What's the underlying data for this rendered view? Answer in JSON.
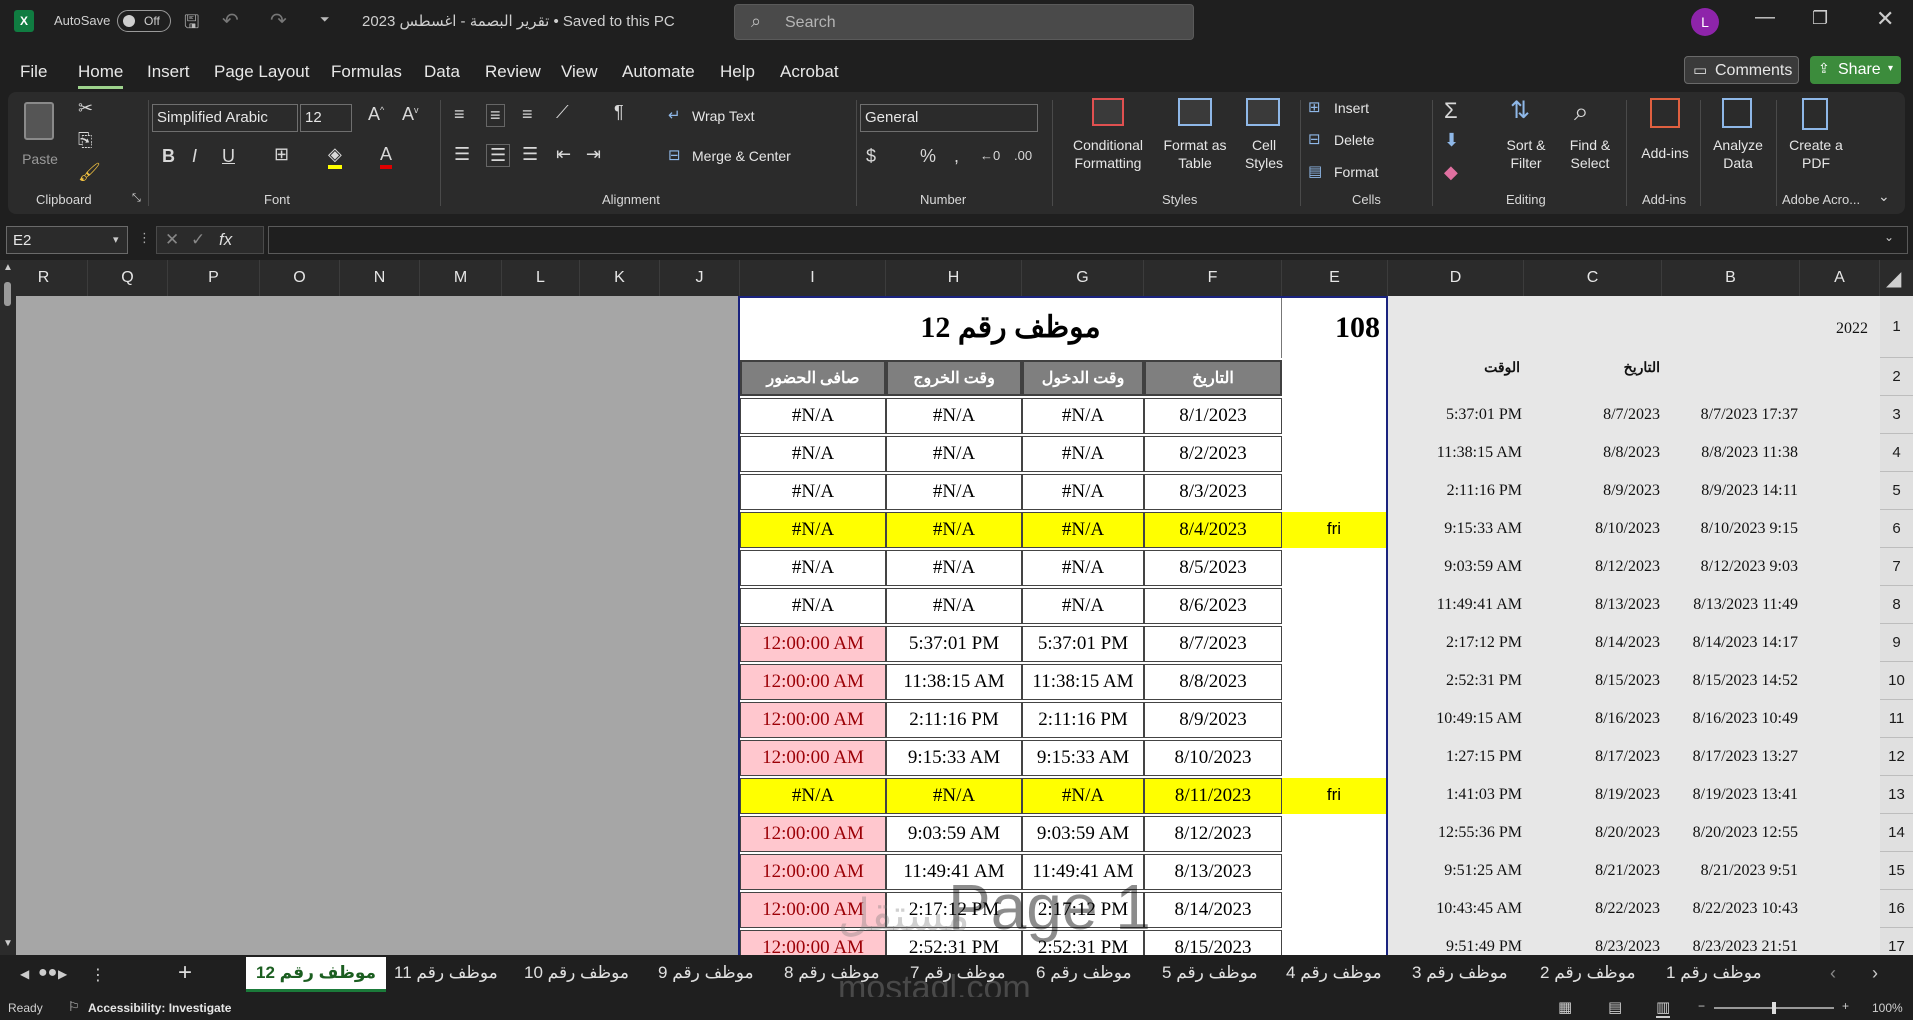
{
  "titlebar": {
    "app_icon": "excel-icon",
    "autosave_label": "AutoSave",
    "autosave_state": "Off",
    "doc_title": "تقرير البصمة - اغسطس 2023 • Saved to this PC",
    "search_placeholder": "Search",
    "user_initial": "L"
  },
  "menu": {
    "items": [
      "File",
      "Home",
      "Insert",
      "Page Layout",
      "Formulas",
      "Data",
      "Review",
      "View",
      "Automate",
      "Help",
      "Acrobat"
    ],
    "active": "Home",
    "comments_label": "Comments",
    "share_label": "Share"
  },
  "ribbon": {
    "clipboard": {
      "paste": "Paste",
      "group": "Clipboard"
    },
    "font": {
      "name": "Simplified Arabic",
      "size": "12",
      "group": "Font"
    },
    "alignment": {
      "wrap": "Wrap Text",
      "merge": "Merge & Center",
      "group": "Alignment"
    },
    "number": {
      "format": "General",
      "group": "Number"
    },
    "styles": {
      "conditional": "Conditional Formatting",
      "format_table": "Format as Table",
      "cell_styles": "Cell Styles",
      "group": "Styles"
    },
    "cells": {
      "insert": "Insert",
      "delete": "Delete",
      "format": "Format",
      "group": "Cells"
    },
    "editing": {
      "sort": "Sort & Filter",
      "find": "Find & Select",
      "group": "Editing"
    },
    "addins": {
      "addins": "Add-ins",
      "analyze": "Analyze Data",
      "group": "Add-ins"
    },
    "acrobat": {
      "create": "Create a PDF",
      "group": "Adobe Acro..."
    }
  },
  "formula": {
    "name_box": "E2",
    "fx": "fx",
    "content": ""
  },
  "columns": [
    "R",
    "Q",
    "P",
    "O",
    "N",
    "M",
    "L",
    "K",
    "J",
    "I",
    "H",
    "G",
    "F",
    "E",
    "D",
    "C",
    "B",
    "A"
  ],
  "rows": [
    "1",
    "2",
    "3",
    "4",
    "5",
    "6",
    "7",
    "8",
    "9",
    "10",
    "11",
    "12",
    "13",
    "14",
    "15",
    "16",
    "17"
  ],
  "report": {
    "title": "موظف رقم 12",
    "code": "108",
    "headers": [
      "صافى الحضور",
      "وقت الخروج",
      "وقت الدخول",
      "التاريخ"
    ],
    "rows": [
      {
        "net": "#N/A",
        "out": "#N/A",
        "in": "#N/A",
        "date": "8/1/2023",
        "day": "",
        "hl": "none"
      },
      {
        "net": "#N/A",
        "out": "#N/A",
        "in": "#N/A",
        "date": "8/2/2023",
        "day": "",
        "hl": "none"
      },
      {
        "net": "#N/A",
        "out": "#N/A",
        "in": "#N/A",
        "date": "8/3/2023",
        "day": "",
        "hl": "none"
      },
      {
        "net": "#N/A",
        "out": "#N/A",
        "in": "#N/A",
        "date": "8/4/2023",
        "day": "fri",
        "hl": "yellow"
      },
      {
        "net": "#N/A",
        "out": "#N/A",
        "in": "#N/A",
        "date": "8/5/2023",
        "day": "",
        "hl": "none"
      },
      {
        "net": "#N/A",
        "out": "#N/A",
        "in": "#N/A",
        "date": "8/6/2023",
        "day": "",
        "hl": "none"
      },
      {
        "net": "12:00:00 AM",
        "out": "5:37:01 PM",
        "in": "5:37:01 PM",
        "date": "8/7/2023",
        "day": "",
        "hl": "pink"
      },
      {
        "net": "12:00:00 AM",
        "out": "11:38:15 AM",
        "in": "11:38:15 AM",
        "date": "8/8/2023",
        "day": "",
        "hl": "pink"
      },
      {
        "net": "12:00:00 AM",
        "out": "2:11:16 PM",
        "in": "2:11:16 PM",
        "date": "8/9/2023",
        "day": "",
        "hl": "pink"
      },
      {
        "net": "12:00:00 AM",
        "out": "9:15:33 AM",
        "in": "9:15:33 AM",
        "date": "8/10/2023",
        "day": "",
        "hl": "pink"
      },
      {
        "net": "#N/A",
        "out": "#N/A",
        "in": "#N/A",
        "date": "8/11/2023",
        "day": "fri",
        "hl": "yellow"
      },
      {
        "net": "12:00:00 AM",
        "out": "9:03:59 AM",
        "in": "9:03:59 AM",
        "date": "8/12/2023",
        "day": "",
        "hl": "pink"
      },
      {
        "net": "12:00:00 AM",
        "out": "11:49:41 AM",
        "in": "11:49:41 AM",
        "date": "8/13/2023",
        "day": "",
        "hl": "pink"
      },
      {
        "net": "12:00:00 AM",
        "out": "2:17:12 PM",
        "in": "2:17:12 PM",
        "date": "8/14/2023",
        "day": "",
        "hl": "pink"
      },
      {
        "net": "12:00:00 AM",
        "out": "2:52:31 PM",
        "in": "2:52:31 PM",
        "date": "8/15/2023",
        "day": "",
        "hl": "pink"
      }
    ]
  },
  "raw": {
    "a1": "2022",
    "hdr_time": "الوقت",
    "hdr_date": "التاريخ",
    "rows": [
      {
        "d": "5:37:01 PM",
        "c": "8/7/2023",
        "b": "8/7/2023 17:37"
      },
      {
        "d": "11:38:15 AM",
        "c": "8/8/2023",
        "b": "8/8/2023 11:38"
      },
      {
        "d": "2:11:16 PM",
        "c": "8/9/2023",
        "b": "8/9/2023 14:11"
      },
      {
        "d": "9:15:33 AM",
        "c": "8/10/2023",
        "b": "8/10/2023 9:15"
      },
      {
        "d": "9:03:59 AM",
        "c": "8/12/2023",
        "b": "8/12/2023 9:03"
      },
      {
        "d": "11:49:41 AM",
        "c": "8/13/2023",
        "b": "8/13/2023 11:49"
      },
      {
        "d": "2:17:12 PM",
        "c": "8/14/2023",
        "b": "8/14/2023 14:17"
      },
      {
        "d": "2:52:31 PM",
        "c": "8/15/2023",
        "b": "8/15/2023 14:52"
      },
      {
        "d": "10:49:15 AM",
        "c": "8/16/2023",
        "b": "8/16/2023 10:49"
      },
      {
        "d": "1:27:15 PM",
        "c": "8/17/2023",
        "b": "8/17/2023 13:27"
      },
      {
        "d": "1:41:03 PM",
        "c": "8/19/2023",
        "b": "8/19/2023 13:41"
      },
      {
        "d": "12:55:36 PM",
        "c": "8/20/2023",
        "b": "8/20/2023 12:55"
      },
      {
        "d": "9:51:25 AM",
        "c": "8/21/2023",
        "b": "8/21/2023 9:51"
      },
      {
        "d": "10:43:45 AM",
        "c": "8/22/2023",
        "b": "8/22/2023 10:43"
      },
      {
        "d": "9:51:49 PM",
        "c": "8/23/2023",
        "b": "8/23/2023 21:51"
      }
    ]
  },
  "watermark": {
    "page_label": "Page 1",
    "site": "mostaql.com",
    "arabic": "مستقل"
  },
  "sheets": {
    "tabs": [
      "موظف رقم 12",
      "موظف رقم 11",
      "موظف رقم 10",
      "موظف رقم 9",
      "موظف رقم 8",
      "موظف رقم 7",
      "موظف رقم 6",
      "موظف رقم 5",
      "موظف رقم 4",
      "موظف رقم 3",
      "موظف رقم 2",
      "موظف رقم 1"
    ],
    "active_index": 0,
    "add": "+"
  },
  "status": {
    "ready": "Ready",
    "accessibility": "Accessibility: Investigate",
    "zoom": "100%"
  },
  "colors": {
    "yellow": "#ffff00",
    "pink": "#ffc7ce",
    "pink_text": "#9c0006",
    "accent": "#9ed38d",
    "share": "#4caf50"
  }
}
